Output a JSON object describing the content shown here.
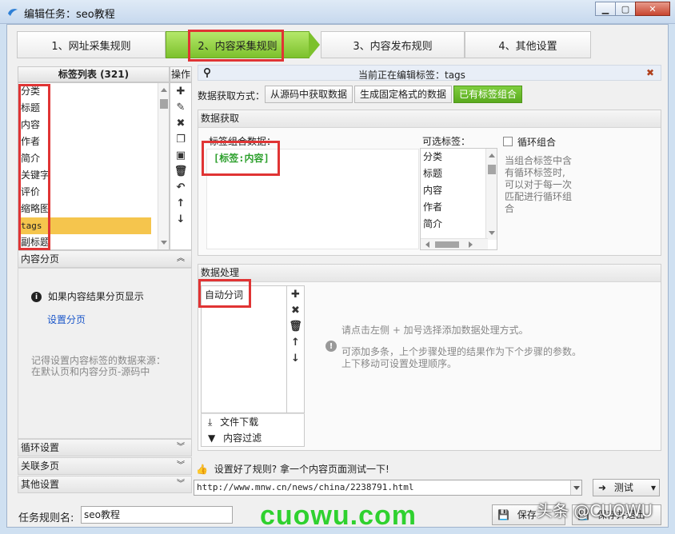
{
  "window": {
    "title": "编辑任务：seo教程"
  },
  "steps": [
    {
      "label": "1、网址采集规则"
    },
    {
      "label": "2、内容采集规则"
    },
    {
      "label": "3、内容发布规则"
    },
    {
      "label": "4、其他设置"
    }
  ],
  "tag_list": {
    "header": "标签列表 (321)",
    "items": [
      "分类",
      "标题",
      "内容",
      "作者",
      "简介",
      "关键字",
      "评价",
      "缩略图",
      "tags",
      "副标题"
    ],
    "selected": "tags"
  },
  "ops_header": "操作",
  "paging": {
    "title": "内容分页",
    "info": "如果内容结果分页显示",
    "link": "设置分页",
    "note_line1": "记得设置内容标签的数据来源：",
    "note_line2": "在默认页和内容分页-源码中"
  },
  "collapsed_sections": [
    "循环设置",
    "关联多页",
    "其他设置"
  ],
  "editing_bar": {
    "text": "当前正在编辑标签：tags"
  },
  "method": {
    "label": "数据获取方式：",
    "options": [
      "从源码中获取数据",
      "生成固定格式的数据",
      "已有标签组合"
    ],
    "active": "已有标签组合"
  },
  "fetch": {
    "title": "数据获取",
    "combo_label": "标签组合数据：",
    "combo_value": "[标签:内容]",
    "optional_label": "可选标签：",
    "optional_items": [
      "分类",
      "标题",
      "内容",
      "作者",
      "简介"
    ],
    "loop_label": "循环组合",
    "loop_help": "当组合标签中含有循环标签时,可以对于每一次匹配进行循环组合"
  },
  "process": {
    "title": "数据处理",
    "items": [
      "自动分词"
    ],
    "foot_items": [
      "文件下载",
      "内容过滤"
    ],
    "hint1": "请点击左侧 + 加号选择添加数据处理方式。",
    "hint2": "可添加多条，上个步骤处理的结果作为下个步骤的参数。上下移动可设置处理顺序。"
  },
  "test": {
    "hint": "设置好了规则? 拿一个内容页面测试一下!",
    "url": "http://www.mnw.cn/news/china/2238791.html",
    "button": "测试"
  },
  "footer": {
    "name_label": "任务规则名:",
    "name_value": "seo教程",
    "save": "保存",
    "save_exit": "保存并退出"
  },
  "watermark": {
    "big": "cuowu.com",
    "small": "头条 @CUOWU"
  },
  "colors": {
    "accent_green": "#7cc12c",
    "highlight": "#e03434",
    "selected_row": "#f5c54d"
  }
}
